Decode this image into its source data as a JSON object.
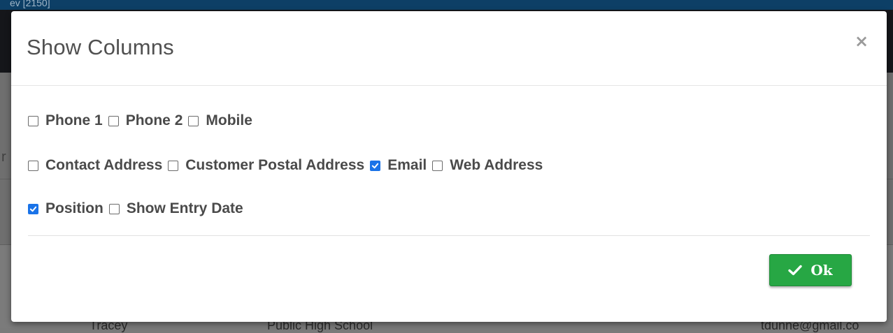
{
  "background": {
    "topbar_text": "ev [2150]",
    "left_fragment": "r",
    "table_row": [
      "Tracey",
      "Public High School",
      "tdunne@gmail.co"
    ]
  },
  "modal": {
    "title": "Show Columns",
    "close_icon": "×",
    "rows": [
      [
        {
          "label": "Phone 1",
          "checked": false
        },
        {
          "label": "Phone 2",
          "checked": false
        },
        {
          "label": "Mobile",
          "checked": false
        }
      ],
      [
        {
          "label": "Contact Address",
          "checked": false
        },
        {
          "label": "Customer Postal Address",
          "checked": false
        },
        {
          "label": "Email",
          "checked": true
        },
        {
          "label": "Web Address",
          "checked": false
        }
      ],
      [
        {
          "label": "Position",
          "checked": true
        },
        {
          "label": "Show Entry Date",
          "checked": false
        }
      ]
    ],
    "ok_button": {
      "label": "Ok",
      "icon": "checkmark-icon",
      "color": "#27a744"
    }
  },
  "colors": {
    "checkbox_checked": "#1a73e8",
    "title_text": "#505050",
    "label_text": "#4a4a4a"
  }
}
